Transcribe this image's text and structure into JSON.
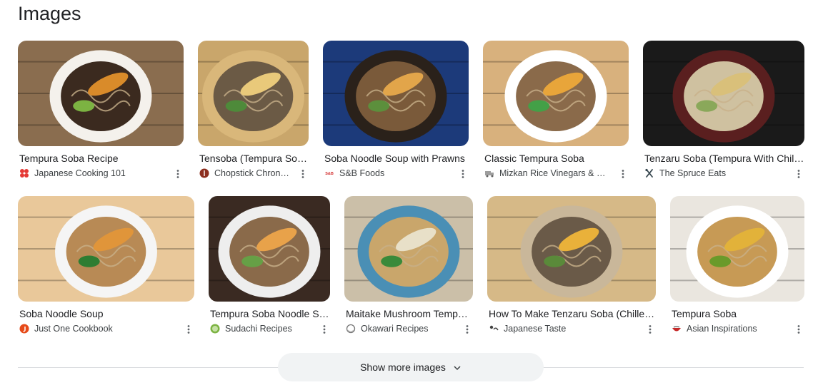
{
  "section": {
    "title": "Images"
  },
  "rows": [
    [
      {
        "caption": "Tempura Soba Recipe",
        "source": "Japanese Cooking 101",
        "favicon": "red-flower-icon",
        "fav_color": "#e53935",
        "bg": "#8a6d4f",
        "bowl": "#f4f1ec",
        "broth": "#3b2a1f",
        "accent": "#d98b2a",
        "green": "#7cb342"
      },
      {
        "caption": "Tensoba (Tempura Soba) Recipe",
        "source": "Chopstick Chronicles",
        "favicon": "chopstick-circle-icon",
        "fav_color": "#8d2f1f",
        "bg": "#c9a66b",
        "bowl": "#d9b77a",
        "broth": "#6b5a45",
        "accent": "#e9c97a",
        "green": "#4e8a3a"
      },
      {
        "caption": "Soba Noodle Soup with Prawns",
        "source": "S&B Foods",
        "favicon": "sb-logo-icon",
        "fav_color": "#d32f2f",
        "bg": "#1c3a7a",
        "bowl": "#2a211a",
        "broth": "#7a5a3a",
        "accent": "#e2a54a",
        "green": "#5c8f3c"
      },
      {
        "caption": "Classic Tempura Soba",
        "source": "Mizkan Rice Vinegars & Sauces",
        "favicon": "truck-icon",
        "fav_color": "#9e9e9e",
        "bg": "#d8b17d",
        "bowl": "#ffffff",
        "broth": "#8a6a4a",
        "accent": "#e8a53a",
        "green": "#43a047"
      },
      {
        "caption": "Tenzaru Soba (Tempura With Chilled Soba)",
        "source": "The Spruce Eats",
        "favicon": "utensils-icon",
        "fav_color": "#37474f",
        "bg": "#1a1a1a",
        "bowl": "#5a1f1f",
        "broth": "#cfc1a0",
        "accent": "#d9c07a",
        "green": "#8aa85a"
      }
    ],
    [
      {
        "caption": "Soba Noodle Soup",
        "source": "Just One Cookbook",
        "favicon": "joc-logo-icon",
        "fav_color": "#e64a19",
        "bg": "#e9c89a",
        "bowl": "#f5f5f5",
        "broth": "#b88a55",
        "accent": "#e0953a",
        "green": "#2e7d32"
      },
      {
        "caption": "Tempura Soba Noodle Soup",
        "source": "Sudachi Recipes",
        "favicon": "lime-icon",
        "fav_color": "#7cb342",
        "bg": "#3a2a22",
        "bowl": "#eeeeee",
        "broth": "#8a6a4a",
        "accent": "#e8a24a",
        "green": "#66a046"
      },
      {
        "caption": "Maitake Mushroom Tempura Soba",
        "source": "Okawari Recipes",
        "favicon": "ring-icon",
        "fav_color": "#757575",
        "bg": "#cbbfa8",
        "bowl": "#4a8fb5",
        "broth": "#c9a66b",
        "accent": "#e8e0c8",
        "green": "#3a8a3a"
      },
      {
        "caption": "How To Make Tenzaru Soba (Chilled Soba with Tempura)",
        "source": "Japanese Taste",
        "favicon": "jt-logo-icon",
        "fav_color": "#424242",
        "bg": "#d6b987",
        "bowl": "#c9b79a",
        "broth": "#6a5a48",
        "accent": "#e9b13a",
        "green": "#5a8a3a"
      },
      {
        "caption": "Tempura Soba",
        "source": "Asian Inspirations",
        "favicon": "bowl-icon",
        "fav_color": "#c62828",
        "bg": "#eae6df",
        "bowl": "#ffffff",
        "broth": "#c79a55",
        "accent": "#e2b23a",
        "green": "#6a9a2a"
      }
    ]
  ],
  "show_more": {
    "label": "Show more images",
    "icon": "chevron-down-icon"
  }
}
